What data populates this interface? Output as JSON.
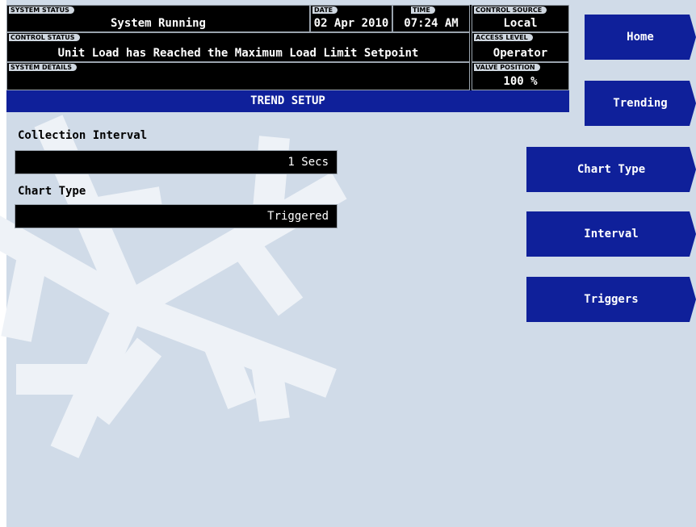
{
  "header": {
    "system_status": {
      "tag": "SYSTEM STATUS",
      "value": "System Running"
    },
    "date": {
      "tag": "DATE",
      "value": "02 Apr 2010"
    },
    "time": {
      "tag": "TIME",
      "value": "07:24 AM"
    },
    "control_source": {
      "tag": "CONTROL SOURCE",
      "value": "Local"
    },
    "control_status": {
      "tag": "CONTROL STATUS",
      "value": "Unit Load has Reached the Maximum Load Limit Setpoint"
    },
    "access_level": {
      "tag": "ACCESS LEVEL",
      "value": "Operator"
    },
    "system_details": {
      "tag": "SYSTEM DETAILS",
      "value": ""
    },
    "valve_position": {
      "tag": "VALVE POSITION",
      "value": "100 %"
    }
  },
  "title_bar": "TREND SETUP",
  "fields": {
    "collection_interval": {
      "label": "Collection Interval",
      "value": "1 Secs"
    },
    "chart_type": {
      "label": "Chart Type",
      "value": "Triggered"
    }
  },
  "nav": {
    "home": "Home",
    "trending": "Trending",
    "chart_type": "Chart Type",
    "interval": "Interval",
    "triggers": "Triggers"
  },
  "colors": {
    "background": "#d0dbe8",
    "accent_blue": "#0f209a",
    "status_black": "#000000",
    "watermark": "#eef2f7"
  },
  "icons": {
    "watermark": "snowflake-icon"
  }
}
